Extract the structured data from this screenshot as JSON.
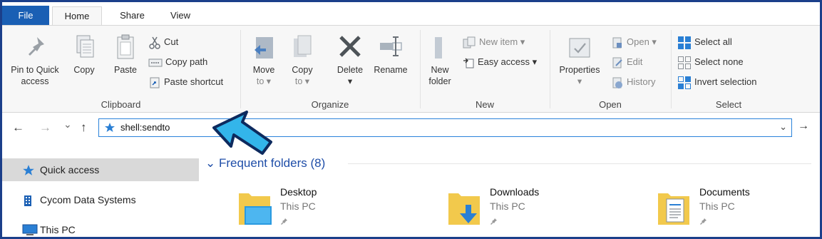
{
  "tabs": {
    "file": "File",
    "home": "Home",
    "share": "Share",
    "view": "View"
  },
  "clipboard": {
    "label": "Clipboard",
    "pin_line1": "Pin to Quick",
    "pin_line2": "access",
    "copy": "Copy",
    "paste": "Paste",
    "cut": "Cut",
    "copy_path": "Copy path",
    "paste_shortcut": "Paste shortcut"
  },
  "organize": {
    "label": "Organize",
    "move_line1": "Move",
    "move_line2": "to ▾",
    "copy_line1": "Copy",
    "copy_line2": "to ▾",
    "delete": "Delete",
    "delete_arrow": "▾",
    "rename": "Rename"
  },
  "new": {
    "label": "New",
    "folder_line1": "New",
    "folder_line2": "folder",
    "new_item": "New item ▾",
    "easy_access": "Easy access ▾"
  },
  "open": {
    "label": "Open",
    "properties": "Properties",
    "properties_arrow": "▾",
    "open": "Open ▾",
    "edit": "Edit",
    "history": "History"
  },
  "select": {
    "label": "Select",
    "select_all": "Select all",
    "select_none": "Select none",
    "invert": "Invert selection"
  },
  "nav": {
    "back": "←",
    "forward": "→",
    "recent": "⌄",
    "up": "↑"
  },
  "address": {
    "value": "shell:sendto",
    "dropdown": "⌄",
    "go": "→"
  },
  "navpane": {
    "items": [
      {
        "label": "Quick access"
      },
      {
        "label": "Cycom Data Systems"
      },
      {
        "label": "This PC"
      }
    ]
  },
  "content": {
    "section_title": "⌄ Frequent folders (8)",
    "folders": [
      {
        "name": "Desktop",
        "location": "This PC"
      },
      {
        "name": "Downloads",
        "location": "This PC"
      },
      {
        "name": "Documents",
        "location": "This PC"
      }
    ]
  },
  "colors": {
    "accent": "#1a5fb4",
    "callout": "#33b5ea",
    "frame": "#1b3f8a"
  }
}
